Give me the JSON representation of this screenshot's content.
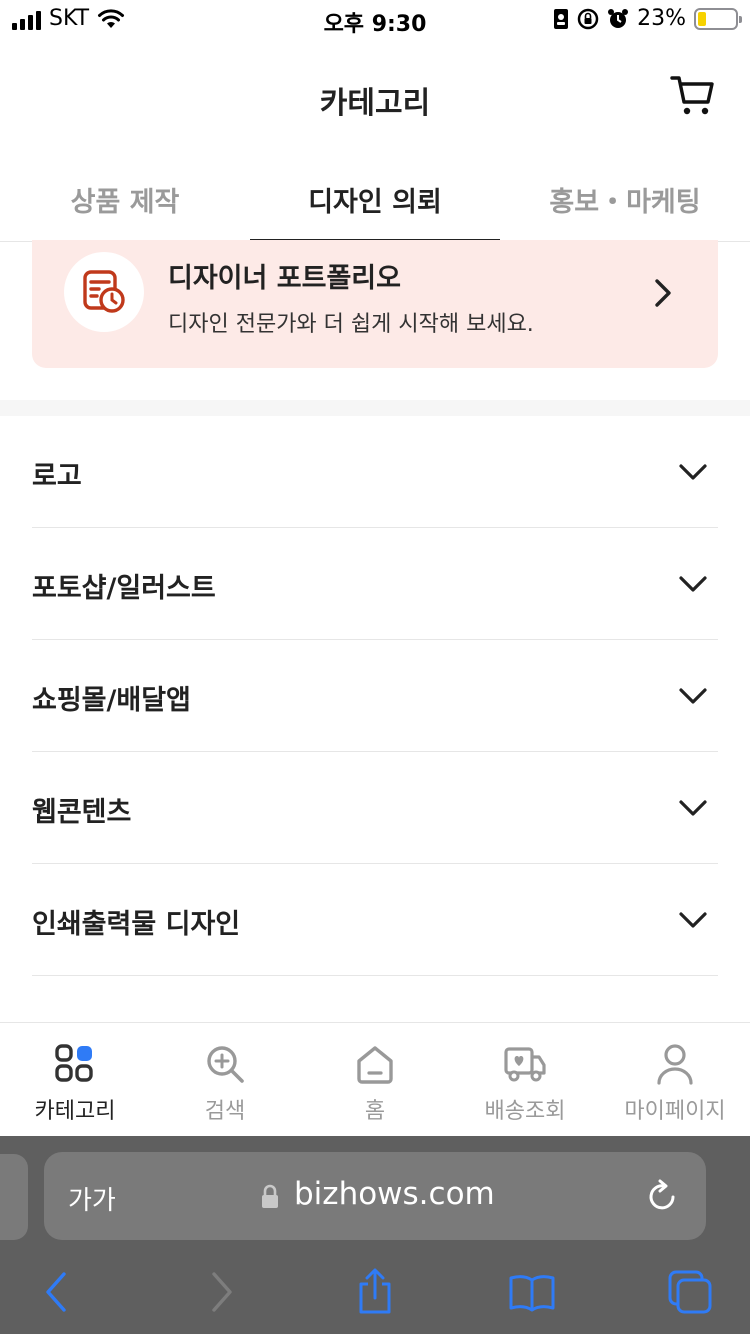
{
  "status_bar": {
    "carrier": "SKT",
    "time": "오후 9:30",
    "battery": "23%",
    "battery_level": 0.23,
    "icons": [
      "signal-icon",
      "wifi-icon",
      "portrait-icon",
      "rotation-lock-icon",
      "alarm-icon",
      "battery-icon"
    ]
  },
  "header": {
    "title": "카테고리",
    "cart_icon": "cart-icon"
  },
  "tabs": [
    {
      "label": "상품 제작",
      "active": false
    },
    {
      "label": "디자인 의뢰",
      "active": true
    },
    {
      "label": "홍보・마케팅",
      "active": false
    }
  ],
  "banner": {
    "title": "디자이너 포트폴리오",
    "subtitle": "디자인 전문가와 더 쉽게 시작해 보세요.",
    "icon": "portfolio-clock-icon",
    "accent": "#c0391b",
    "background": "#fdeae7"
  },
  "categories": [
    {
      "label": "로고"
    },
    {
      "label": "포토샵/일러스트"
    },
    {
      "label": "쇼핑몰/배달앱"
    },
    {
      "label": "웹콘텐츠"
    },
    {
      "label": "인쇄출력물 디자인"
    }
  ],
  "bottom_nav": [
    {
      "label": "카테고리",
      "icon": "category-icon",
      "active": true
    },
    {
      "label": "검색",
      "icon": "search-icon",
      "active": false
    },
    {
      "label": "홈",
      "icon": "home-icon",
      "active": false
    },
    {
      "label": "배송조회",
      "icon": "delivery-truck-icon",
      "active": false
    },
    {
      "label": "마이페이지",
      "icon": "user-icon",
      "active": false
    }
  ],
  "safari": {
    "text_size_label": "가가",
    "url": "bizhows.com",
    "accent": "#2f7bf6"
  }
}
